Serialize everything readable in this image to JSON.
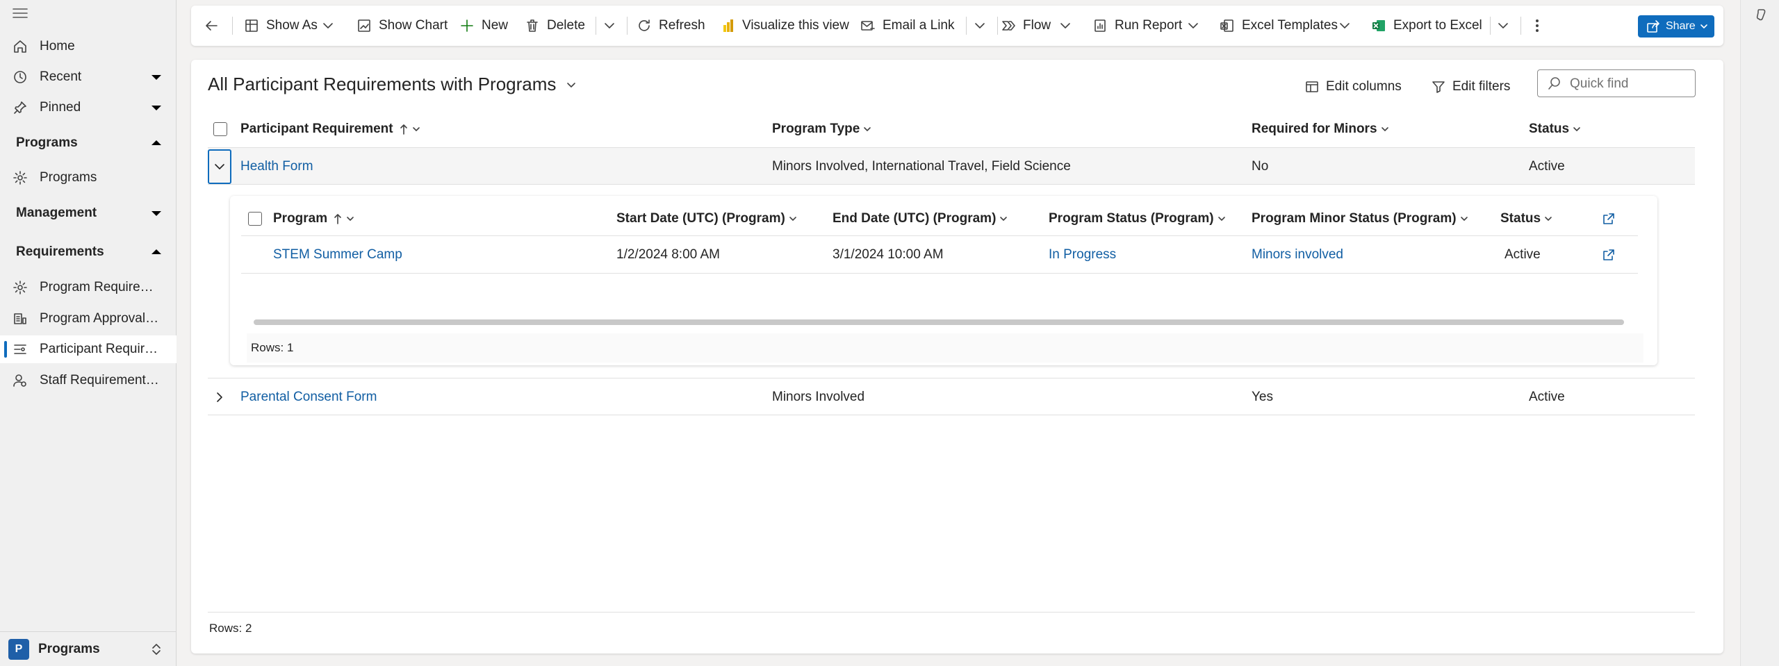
{
  "sidebar": {
    "items": [
      {
        "label": "Home",
        "icon": "home-icon"
      },
      {
        "label": "Recent",
        "icon": "clock-icon"
      },
      {
        "label": "Pinned",
        "icon": "pin-icon"
      }
    ],
    "groups": [
      {
        "label": "Programs",
        "expanded": true,
        "items": [
          {
            "label": "Programs",
            "icon": "gear-icon"
          }
        ]
      },
      {
        "label": "Management",
        "expanded": false,
        "items": []
      },
      {
        "label": "Requirements",
        "expanded": true,
        "items": [
          {
            "label": "Program Requirements",
            "icon": "gear-icon"
          },
          {
            "label": "Program Approval Overview",
            "icon": "people-icon"
          },
          {
            "label": "Participant Requirements",
            "icon": "list-icon",
            "selected": true
          },
          {
            "label": "Staff Requirements by Program",
            "icon": "staff-icon"
          }
        ]
      }
    ],
    "area": {
      "badge": "P",
      "label": "Programs"
    }
  },
  "toolbar": {
    "show_as": "Show As",
    "show_chart": "Show Chart",
    "new": "New",
    "delete": "Delete",
    "refresh": "Refresh",
    "visualize": "Visualize this view",
    "email_link": "Email a Link",
    "flow": "Flow",
    "run_report": "Run Report",
    "excel_templates": "Excel Templates",
    "export_excel": "Export to Excel",
    "share": "Share"
  },
  "view": {
    "title": "All Participant Requirements with Programs",
    "edit_columns": "Edit columns",
    "edit_filters": "Edit filters",
    "quick_find_placeholder": "Quick find"
  },
  "grid": {
    "columns": [
      "Participant Requirement",
      "Program Type",
      "Required for Minors",
      "Status"
    ],
    "rows": [
      {
        "requirement": "Health Form",
        "program_type": "Minors Involved, International Travel, Field Science",
        "required_minors": "No",
        "status": "Active",
        "expanded": true
      },
      {
        "requirement": "Parental Consent Form",
        "program_type": "Minors Involved",
        "required_minors": "Yes",
        "status": "Active",
        "expanded": false
      }
    ],
    "footer": "Rows: 2"
  },
  "subgrid": {
    "columns": [
      "Program",
      "Start Date (UTC) (Program)",
      "End Date (UTC) (Program)",
      "Program Status (Program)",
      "Program Minor Status (Program)",
      "Status"
    ],
    "rows": [
      {
        "program": "STEM Summer Camp",
        "start": "1/2/2024 8:00 AM",
        "end": "3/1/2024 10:00 AM",
        "program_status": "In Progress",
        "minor_status": "Minors involved",
        "status": "Active"
      }
    ],
    "footer": "Rows: 1"
  },
  "colors": {
    "accent": "#0f6cbd",
    "link": "#115ea3"
  }
}
